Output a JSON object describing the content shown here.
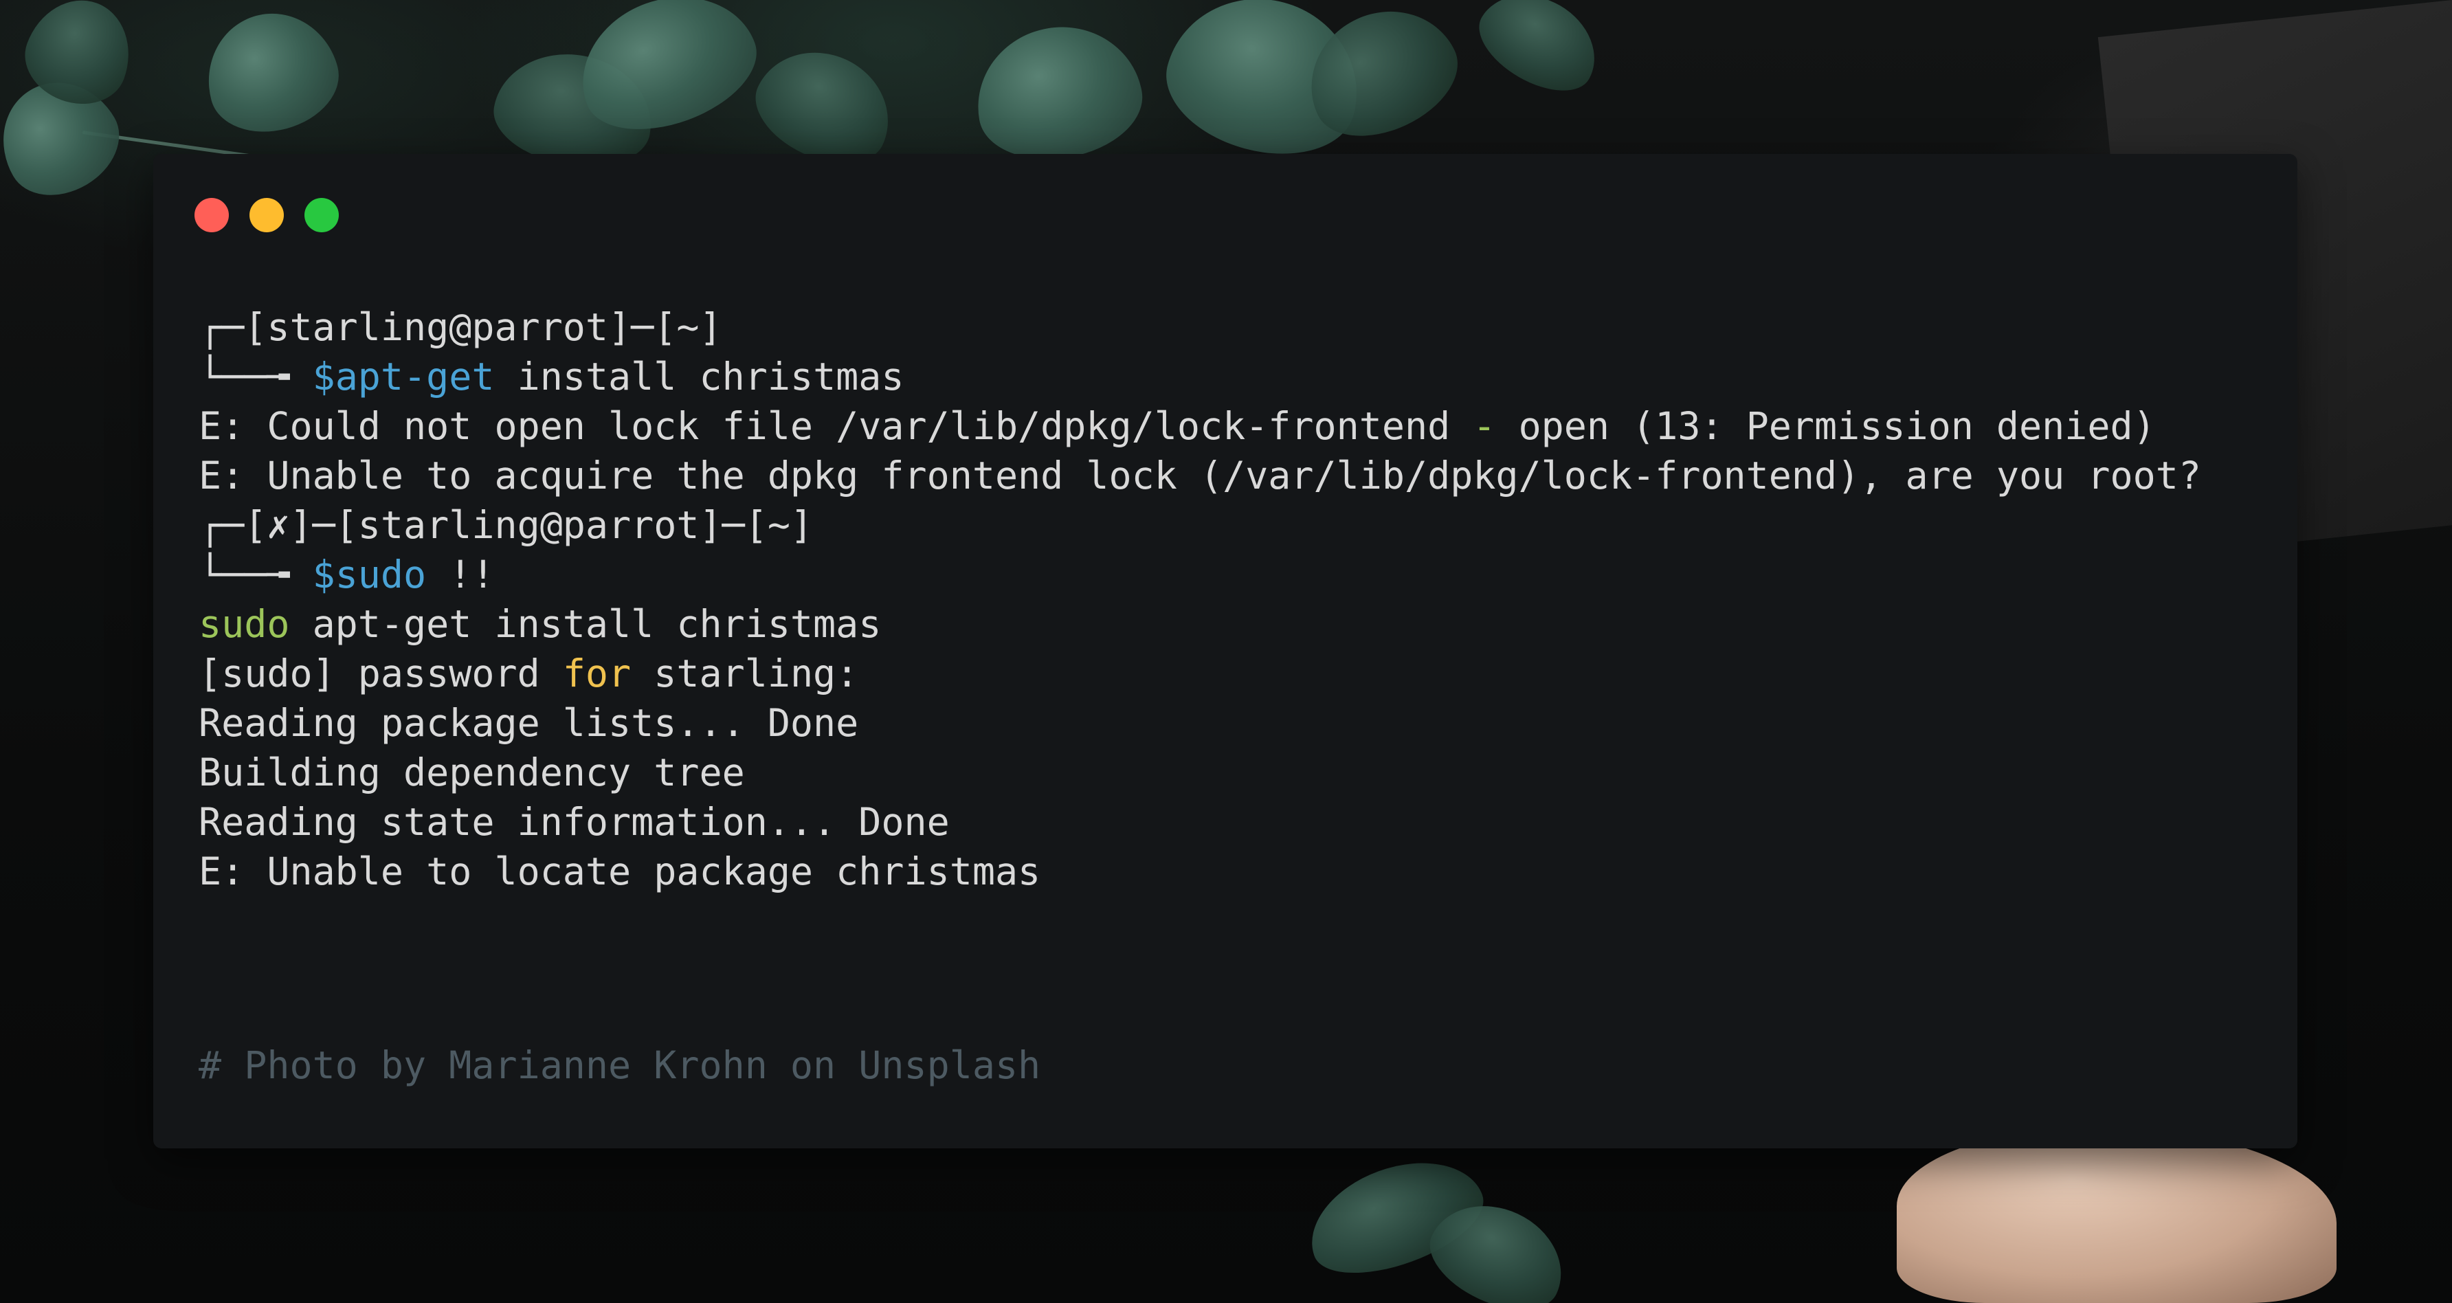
{
  "window": {
    "controls": [
      {
        "name": "close",
        "color": "#ff5f57"
      },
      {
        "name": "minimize",
        "color": "#febc2e"
      },
      {
        "name": "maximize",
        "color": "#28c840"
      }
    ]
  },
  "terminal": {
    "lines": [
      {
        "segments": [
          {
            "text": "┌─[starling@parrot]─[~]",
            "color": "default"
          }
        ]
      },
      {
        "segments": [
          {
            "text": "└──╼ ",
            "color": "default"
          },
          {
            "text": "$apt-get",
            "color": "blue"
          },
          {
            "text": " install christmas",
            "color": "default"
          }
        ]
      },
      {
        "segments": [
          {
            "text": "E: Could not open lock file /var/lib/dpkg/lock-frontend ",
            "color": "default"
          },
          {
            "text": "-",
            "color": "green"
          },
          {
            "text": " open (13: Permission denied)",
            "color": "default"
          }
        ]
      },
      {
        "segments": [
          {
            "text": "E: Unable to acquire the dpkg frontend lock (/var/lib/dpkg/lock-frontend), are you root?",
            "color": "default"
          }
        ]
      },
      {
        "segments": [
          {
            "text": "┌─[✗]─[starling@parrot]─[~]",
            "color": "default"
          }
        ]
      },
      {
        "segments": [
          {
            "text": "└──╼ ",
            "color": "default"
          },
          {
            "text": "$sudo",
            "color": "blue"
          },
          {
            "text": " !!",
            "color": "default"
          }
        ]
      },
      {
        "segments": [
          {
            "text": "sudo",
            "color": "green"
          },
          {
            "text": " apt-get install christmas",
            "color": "default"
          }
        ]
      },
      {
        "segments": [
          {
            "text": "[sudo] password ",
            "color": "default"
          },
          {
            "text": "for",
            "color": "yellow"
          },
          {
            "text": " starling:",
            "color": "default"
          }
        ]
      },
      {
        "segments": [
          {
            "text": "Reading package lists... Done",
            "color": "default"
          }
        ]
      },
      {
        "segments": [
          {
            "text": "Building dependency tree",
            "color": "default"
          }
        ]
      },
      {
        "segments": [
          {
            "text": "Reading state information... Done",
            "color": "default"
          }
        ]
      },
      {
        "segments": [
          {
            "text": "E: Unable to locate package christmas",
            "color": "default"
          }
        ]
      }
    ],
    "comment": "# Photo by Marianne Krohn on Unsplash"
  },
  "colors": {
    "default": "#d9d9d9",
    "blue": "#4aa3d6",
    "green": "#9cc55a",
    "yellow": "#f0c24f",
    "comment": "#4d5a62",
    "window_bg": "#141618"
  }
}
